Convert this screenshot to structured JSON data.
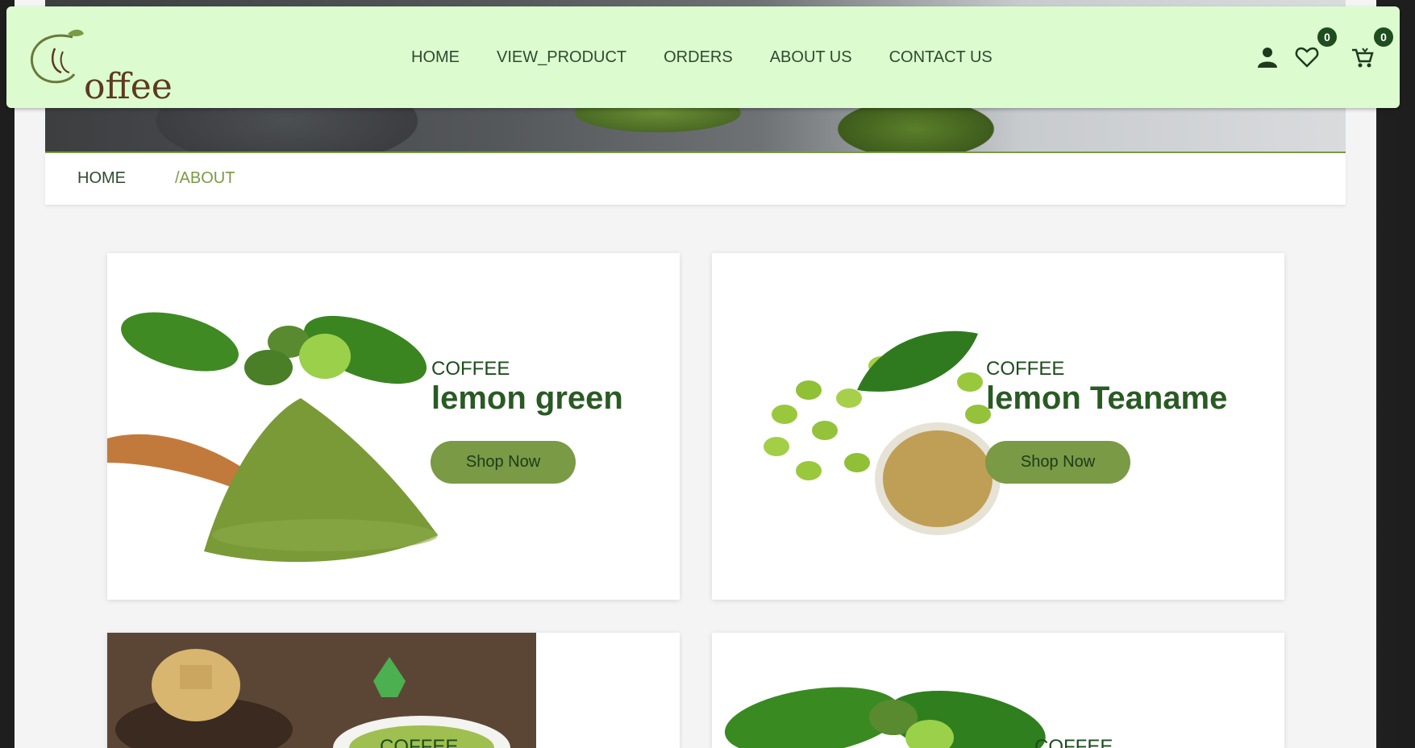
{
  "brand": {
    "logo_text": "offee"
  },
  "nav": {
    "links": [
      "HOME",
      "VIEW_PRODUCT",
      "ORDERS",
      "ABOUT US",
      "CONTACT US"
    ],
    "wishlist_count": "0",
    "cart_count": "0"
  },
  "breadcrumb": {
    "home": "HOME",
    "current": "/ABOUT"
  },
  "cards": [
    {
      "subtitle": "COFFEE",
      "title": "lemon green",
      "button": "Shop Now"
    },
    {
      "subtitle": "COFFEE",
      "title": "lemon Teaname",
      "button": "Shop Now"
    },
    {
      "subtitle": "COFFEE"
    },
    {
      "subtitle": "COFFEE"
    }
  ],
  "colors": {
    "navbar_bg": "#dcfcd0",
    "accent_green": "#7a9a45",
    "dark_green": "#1e4d1e",
    "title_green": "#2a5a24"
  },
  "icons": [
    "user-icon",
    "heart-icon",
    "cart-icon"
  ]
}
